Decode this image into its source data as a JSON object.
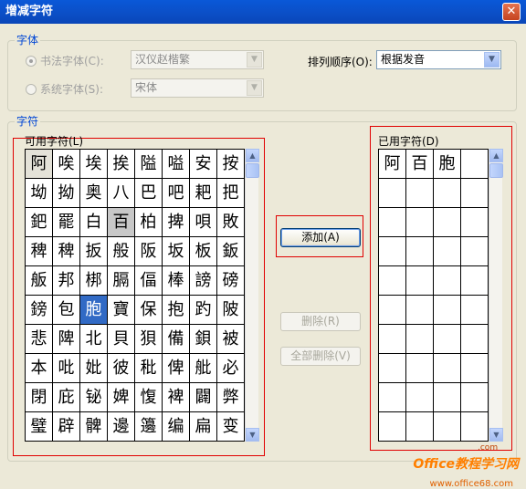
{
  "window": {
    "title": "增减字符",
    "close_glyph": "✕"
  },
  "font_group": {
    "title": "字体",
    "calligraphy_radio": "书法字体(C):",
    "calligraphy_font": "汉仪赵楷繁",
    "system_radio": "系统字体(S):",
    "system_font": "宋体",
    "sort_label": "排列顺序(O):",
    "sort_value": "根据发音"
  },
  "chars_group": {
    "title": "字符",
    "available_label": "可用字符(L)",
    "used_label": "已用字符(D)",
    "available": [
      [
        "阿",
        "唉",
        "埃",
        "挨",
        "隘",
        "嗌",
        "安",
        "按"
      ],
      [
        "坳",
        "拗",
        "奥",
        "八",
        "巴",
        "吧",
        "耙",
        "把"
      ],
      [
        "鈀",
        "罷",
        "白",
        "百",
        "柏",
        "捭",
        "唄",
        "敗"
      ],
      [
        "稗",
        "稗",
        "扳",
        "般",
        "阪",
        "坂",
        "板",
        "鈑"
      ],
      [
        "舨",
        "邦",
        "梆",
        "膈",
        "偪",
        "棒",
        "謗",
        "磅"
      ],
      [
        "鎊",
        "包",
        "胞",
        "寶",
        "保",
        "抱",
        "趵",
        "陂"
      ],
      [
        "悲",
        "陴",
        "北",
        "貝",
        "狽",
        "備",
        "鋇",
        "被"
      ],
      [
        "本",
        "吡",
        "妣",
        "彼",
        "秕",
        "俾",
        "舭",
        "必"
      ],
      [
        "閉",
        "庇",
        "铋",
        "婢",
        "愎",
        "裨",
        "闢",
        "弊"
      ],
      [
        "璧",
        "辟",
        "髀",
        "邊",
        "籩",
        "编",
        "扁",
        "变"
      ]
    ],
    "used": [
      [
        "阿",
        "百",
        "胞",
        ""
      ],
      [
        "",
        "",
        "",
        ""
      ],
      [
        "",
        "",
        "",
        ""
      ],
      [
        "",
        "",
        "",
        ""
      ],
      [
        "",
        "",
        "",
        ""
      ],
      [
        "",
        "",
        "",
        ""
      ],
      [
        "",
        "",
        "",
        ""
      ],
      [
        "",
        "",
        "",
        ""
      ],
      [
        "",
        "",
        "",
        ""
      ],
      [
        "",
        "",
        "",
        ""
      ]
    ]
  },
  "buttons": {
    "add": "添加(A)",
    "delete": "删除(R)",
    "delete_all": "全部删除(V)"
  },
  "watermark": {
    "brand": "Office教程学习网",
    "url": "www.office68.com",
    "com": ".com"
  },
  "icons": {
    "scroll_up": "▲",
    "scroll_down": "▼",
    "dropdown": "▼"
  },
  "colors": {
    "title_bar": "#0b4fc7",
    "selection": "#316ac5",
    "highlight_box": "#e00000",
    "group_title": "#0046d5"
  }
}
